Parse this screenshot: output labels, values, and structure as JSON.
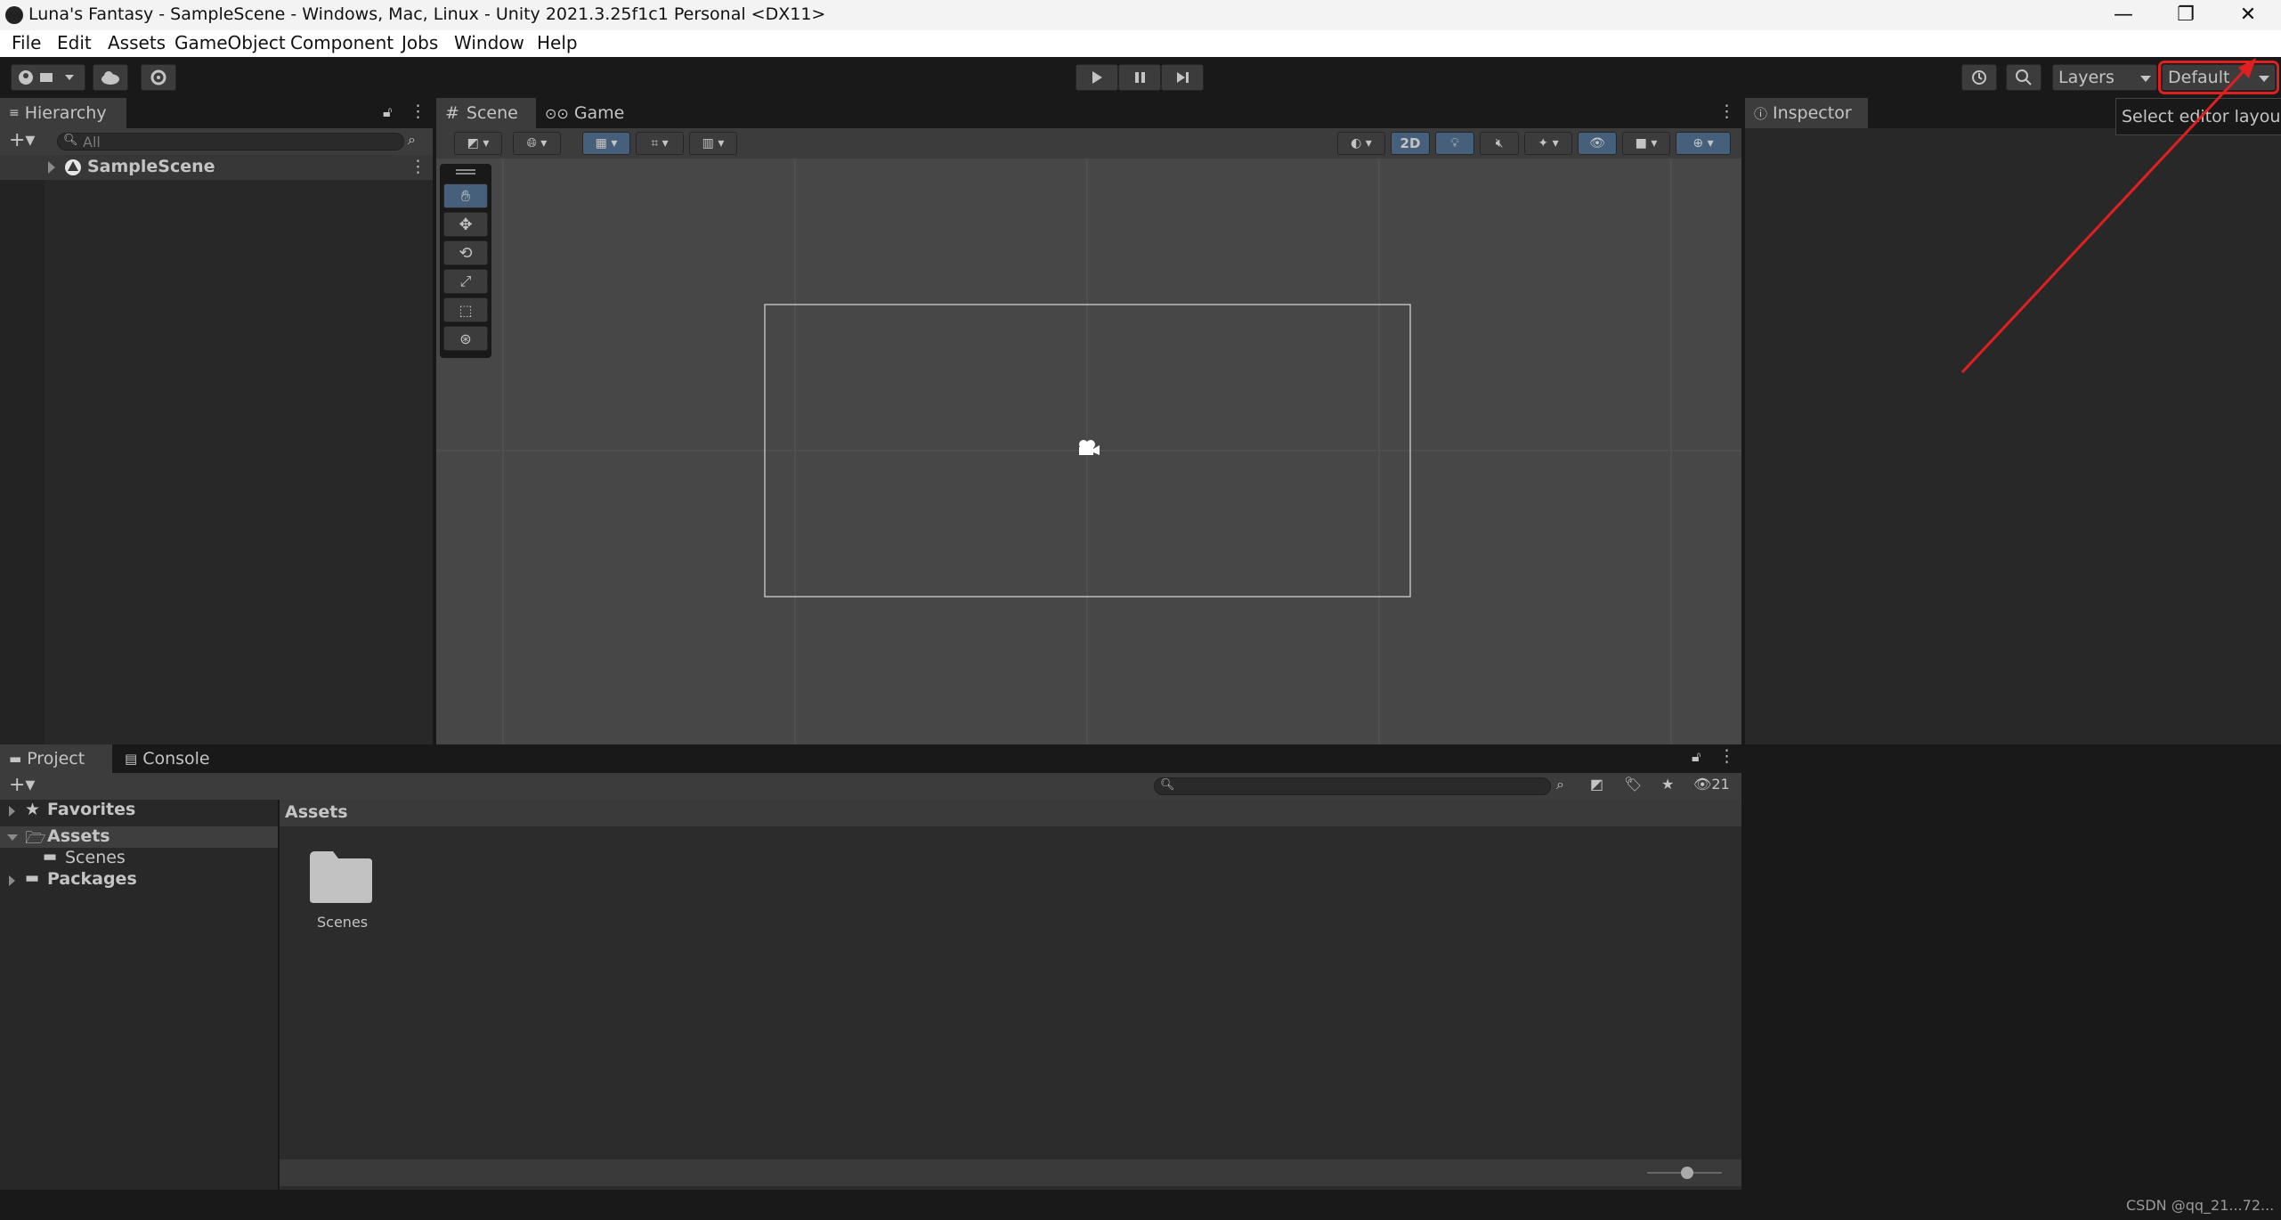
{
  "window": {
    "title": "Luna's Fantasy - SampleScene - Windows, Mac, Linux - Unity 2021.3.25f1c1 Personal <DX11>",
    "minimize_glyph": "—",
    "restore_glyph": "❐",
    "close_glyph": "✕"
  },
  "menu": [
    "File",
    "Edit",
    "Assets",
    "GameObject",
    "Component",
    "Jobs",
    "Window",
    "Help"
  ],
  "toolbar": {
    "layers_label": "Layers",
    "layout_label": "Default",
    "tooltip": "Select editor layout"
  },
  "hierarchy": {
    "tab_label": "Hierarchy",
    "search_placeholder": "All",
    "scene_item": "SampleScene"
  },
  "scene_view": {
    "tabs": [
      "Scene",
      "Game"
    ],
    "toggle_2d_label": "2D"
  },
  "inspector": {
    "tab_label": "Inspector"
  },
  "project": {
    "tabs": [
      "Project",
      "Console"
    ],
    "tree": {
      "favorites": "Favorites",
      "assets": "Assets",
      "scenes": "Scenes",
      "packages": "Packages"
    },
    "breadcrumb": "Assets",
    "hidden_count": "21",
    "items": [
      {
        "name": "Scenes"
      }
    ]
  },
  "watermark": "CSDN @qq_21...72..."
}
